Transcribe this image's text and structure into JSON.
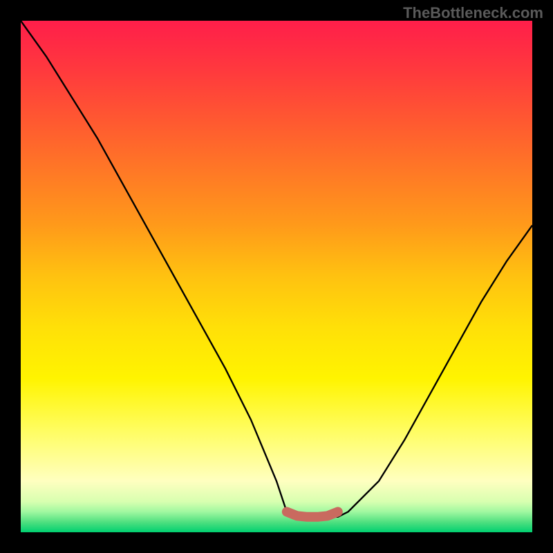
{
  "watermark": "TheBottleneck.com",
  "chart_data": {
    "type": "line",
    "title": "",
    "xlabel": "",
    "ylabel": "",
    "xlim": [
      0,
      100
    ],
    "ylim": [
      0,
      100
    ],
    "grid": false,
    "legend": false,
    "series": [
      {
        "name": "bottleneck-curve",
        "color": "#000000",
        "x": [
          0,
          5,
          10,
          15,
          20,
          25,
          30,
          35,
          40,
          45,
          50,
          52,
          58,
          62,
          64,
          70,
          75,
          80,
          85,
          90,
          95,
          100
        ],
        "values": [
          100,
          93,
          85,
          77,
          68,
          59,
          50,
          41,
          32,
          22,
          10,
          4,
          3,
          3,
          4,
          10,
          18,
          27,
          36,
          45,
          53,
          60
        ]
      },
      {
        "name": "flat-region-marker",
        "color": "#c96a5f",
        "x": [
          52,
          54,
          56,
          58,
          60,
          62
        ],
        "values": [
          4,
          3.2,
          3,
          3,
          3.2,
          4
        ]
      }
    ],
    "gradient_stops": [
      {
        "pos": 0,
        "color": "#ff1e4a"
      },
      {
        "pos": 20,
        "color": "#ff5a30"
      },
      {
        "pos": 40,
        "color": "#ff9a1a"
      },
      {
        "pos": 60,
        "color": "#ffe008"
      },
      {
        "pos": 80,
        "color": "#fffd60"
      },
      {
        "pos": 95,
        "color": "#d8ffb0"
      },
      {
        "pos": 100,
        "color": "#00d070"
      }
    ]
  }
}
